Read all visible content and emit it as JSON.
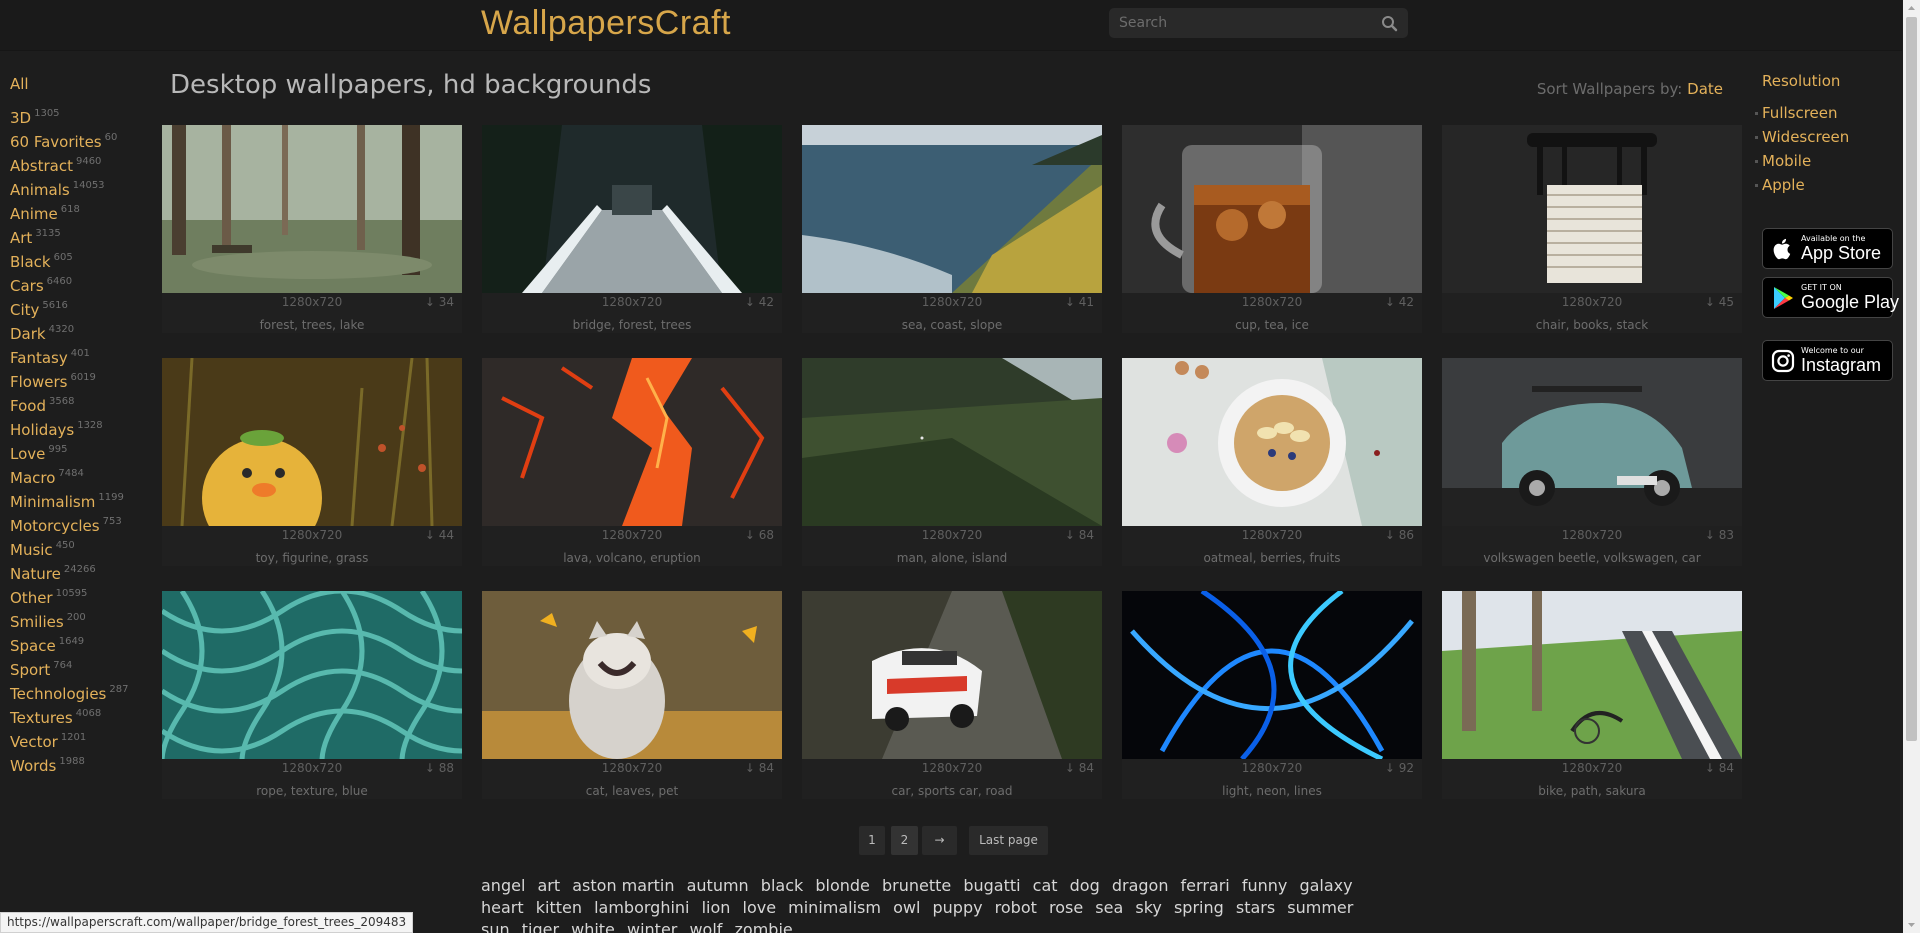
{
  "header": {
    "logo": "WallpapersCraft",
    "search_placeholder": "Search"
  },
  "sidebar": {
    "all_label": "All",
    "categories": [
      {
        "label": "3D",
        "count": "1305"
      },
      {
        "label": "60 Favorites",
        "count": "60"
      },
      {
        "label": "Abstract",
        "count": "9460"
      },
      {
        "label": "Animals",
        "count": "14053"
      },
      {
        "label": "Anime",
        "count": "618"
      },
      {
        "label": "Art",
        "count": "3135"
      },
      {
        "label": "Black",
        "count": "605"
      },
      {
        "label": "Cars",
        "count": "6460"
      },
      {
        "label": "City",
        "count": "5616"
      },
      {
        "label": "Dark",
        "count": "4320"
      },
      {
        "label": "Fantasy",
        "count": "401"
      },
      {
        "label": "Flowers",
        "count": "6019"
      },
      {
        "label": "Food",
        "count": "3568"
      },
      {
        "label": "Holidays",
        "count": "1328"
      },
      {
        "label": "Love",
        "count": "995"
      },
      {
        "label": "Macro",
        "count": "7484"
      },
      {
        "label": "Minimalism",
        "count": "1199"
      },
      {
        "label": "Motorcycles",
        "count": "753"
      },
      {
        "label": "Music",
        "count": "450"
      },
      {
        "label": "Nature",
        "count": "24266"
      },
      {
        "label": "Other",
        "count": "10595"
      },
      {
        "label": "Smilies",
        "count": "200"
      },
      {
        "label": "Space",
        "count": "1649"
      },
      {
        "label": "Sport",
        "count": "764"
      },
      {
        "label": "Technologies",
        "count": "287"
      },
      {
        "label": "Textures",
        "count": "4068"
      },
      {
        "label": "Vector",
        "count": "1201"
      },
      {
        "label": "Words",
        "count": "1988"
      }
    ]
  },
  "main": {
    "title": "Desktop wallpapers, hd backgrounds",
    "sort_label": "Sort Wallpapers by:",
    "sort_value": "Date",
    "wallpapers": [
      {
        "resolution": "1280x720",
        "downloads": "↓ 34",
        "tags": "forest, trees, lake"
      },
      {
        "resolution": "1280x720",
        "downloads": "↓ 42",
        "tags": "bridge, forest, trees"
      },
      {
        "resolution": "1280x720",
        "downloads": "↓ 41",
        "tags": "sea, coast, slope"
      },
      {
        "resolution": "1280x720",
        "downloads": "↓ 42",
        "tags": "cup, tea, ice"
      },
      {
        "resolution": "1280x720",
        "downloads": "↓ 45",
        "tags": "chair, books, stack"
      },
      {
        "resolution": "1280x720",
        "downloads": "↓ 44",
        "tags": "toy, figurine, grass"
      },
      {
        "resolution": "1280x720",
        "downloads": "↓ 68",
        "tags": "lava, volcano, eruption"
      },
      {
        "resolution": "1280x720",
        "downloads": "↓ 84",
        "tags": "man, alone, island"
      },
      {
        "resolution": "1280x720",
        "downloads": "↓ 86",
        "tags": "oatmeal, berries, fruits"
      },
      {
        "resolution": "1280x720",
        "downloads": "↓ 83",
        "tags": "volkswagen beetle, volkswagen, car"
      },
      {
        "resolution": "1280x720",
        "downloads": "↓ 88",
        "tags": "rope, texture, blue"
      },
      {
        "resolution": "1280x720",
        "downloads": "↓ 84",
        "tags": "cat, leaves, pet"
      },
      {
        "resolution": "1280x720",
        "downloads": "↓ 84",
        "tags": "car, sports car, road"
      },
      {
        "resolution": "1280x720",
        "downloads": "↓ 92",
        "tags": "light, neon, lines"
      },
      {
        "resolution": "1280x720",
        "downloads": "↓ 84",
        "tags": "bike, path, sakura"
      }
    ]
  },
  "pagination": {
    "page1": "1",
    "page2": "2",
    "next": "→",
    "last": "Last page"
  },
  "popular_tags": [
    "angel",
    "art",
    "aston martin",
    "autumn",
    "black",
    "blonde",
    "brunette",
    "bugatti",
    "cat",
    "dog",
    "dragon",
    "ferrari",
    "funny",
    "galaxy",
    "heart",
    "kitten",
    "lamborghini",
    "lion",
    "love",
    "minimalism",
    "owl",
    "puppy",
    "robot",
    "rose",
    "sea",
    "sky",
    "spring",
    "stars",
    "summer",
    "sun",
    "tiger",
    "white",
    "winter",
    "wolf",
    "zombie"
  ],
  "right_sidebar": {
    "resolution_heading": "Resolution",
    "items": [
      "Fullscreen",
      "Widescreen",
      "Mobile",
      "Apple"
    ],
    "app_store": {
      "small": "Available on the",
      "big": "App Store"
    },
    "google_play": {
      "small": "GET IT ON",
      "big": "Google Play"
    },
    "instagram": {
      "small": "Welcome to our",
      "big": "Instagram"
    }
  },
  "status_url": "https://wallpaperscraft.com/wallpaper/bridge_forest_trees_209483"
}
